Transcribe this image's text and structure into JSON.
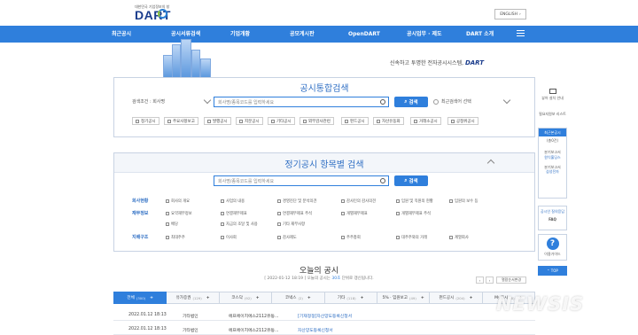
{
  "header": {
    "logo_tagline": "대한민국 기업정보의 창",
    "logo_text": "DART",
    "lang_button": "ENGLISH"
  },
  "nav": [
    "최근공시",
    "공시서류검색",
    "기업개황",
    "공모게시판",
    "OpenDART",
    "공시업무 · 제도",
    "DART 소개"
  ],
  "hero": {
    "slogan": "신속하고 투명한 전자공시시스템,",
    "slogan_brand": "DART"
  },
  "integrated_search": {
    "title": "공시통합검색",
    "condition_label": "검색조건 : 회사명",
    "input_placeholder": "회사명/종목코드를 입력하세요",
    "search_button": "검색",
    "recent_label": "최근검색어 선택",
    "filters": [
      "정기공시",
      "주요사항보고",
      "발행공시",
      "지분공시",
      "기타공시",
      "외부감사관련",
      "펀드공시",
      "자산유동화",
      "거래소공시",
      "공정위공시"
    ]
  },
  "periodic_search": {
    "title": "정기공시 항목별 검색",
    "input_placeholder": "회사명/종목코드를 입력하세요",
    "search_button": "검색",
    "rows": [
      {
        "label": "회사현황",
        "options": [
          "회사의 개요",
          "사업의 내용",
          "경영진단 및 분석의견",
          "감사인의 감사의견",
          "임원 및 직원의 현황",
          "임원의 보수 등"
        ]
      },
      {
        "label": "재무정보",
        "options": [
          "요약재무정보",
          "연결재무제표",
          "연결재무제표 주석",
          "개별재무제표",
          "개별재무제표 주석",
          "배당",
          "자금의 조달 및 사용",
          "기타 재무사항"
        ]
      },
      {
        "label": "지배구조",
        "options": [
          "최대주주",
          "이사회",
          "감사제도",
          "주주총회",
          "대주주와의 거래",
          "계열회사"
        ]
      }
    ]
  },
  "sidebar": {
    "viewer": "뷰어 설치 안내",
    "checklist": "필요지원보 리스트",
    "recent_title": "최근본공시",
    "recent_count": "(총0건)",
    "item1_a": "분기보고서",
    "item1_b": "원익홀딩스",
    "item2_a": "분기보고서",
    "item2_b": "삼성전자",
    "faq_a": "공시인 질의응답",
    "faq_b": "FAQ",
    "guide": "이용가이드",
    "top": "TOP"
  },
  "today": {
    "title": "오늘의 공시",
    "sub_prefix": "[ 2022-01-12 18:19 ] 오늘의 공시는",
    "sub_count": "30초",
    "sub_suffix": "단위로 갱신됩니다.",
    "collapse_btn": "열람순서변경"
  },
  "tabs": [
    {
      "label": "전체",
      "count": "(300)"
    },
    {
      "label": "유가증권",
      "count": "(129)"
    },
    {
      "label": "코스닥",
      "count": "(92)"
    },
    {
      "label": "코넥스",
      "count": "(2)"
    },
    {
      "label": "기타",
      "count": "(118)"
    },
    {
      "label": "5% · 임원보고",
      "count": "(49)"
    },
    {
      "label": "펀드공시",
      "count": "(204)"
    },
    {
      "label": "My공시",
      "count": "(0)"
    }
  ],
  "rows": [
    {
      "time": "2022.01.12 18:13",
      "market": "기타법인",
      "company": "에프에이치에스2112유동...",
      "report": "[기재정정]자산양도등록신청서"
    },
    {
      "time": "2022.01.12 18:13",
      "market": "기타법인",
      "company": "에프에이치에스2112유동...",
      "report": "자산양도등록신청서"
    }
  ],
  "watermark": "NEWSIS",
  "colors": {
    "accent": "#2f7fdc",
    "brand": "#1a3c8c"
  }
}
